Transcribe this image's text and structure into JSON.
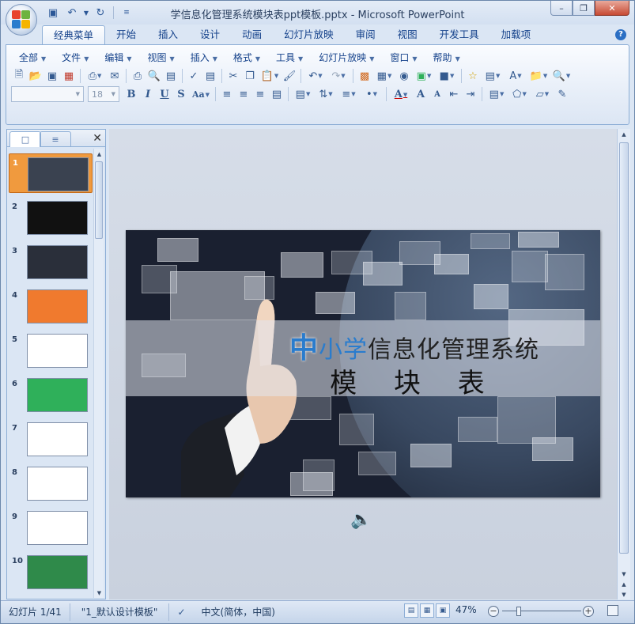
{
  "window": {
    "title": "学信息化管理系统模块表ppt模板.pptx - Microsoft PowerPoint"
  },
  "ribbon_tabs": [
    "经典菜单",
    "开始",
    "插入",
    "设计",
    "动画",
    "幻灯片放映",
    "审阅",
    "视图",
    "开发工具",
    "加载项"
  ],
  "classic_menus": [
    "全部",
    "文件",
    "编辑",
    "视图",
    "插入",
    "格式",
    "工具",
    "幻灯片放映",
    "窗口",
    "帮助"
  ],
  "font": {
    "name_placeholder": "",
    "size": "18"
  },
  "slide": {
    "title_big": "中",
    "title_mid": "小学",
    "title_rest": "信息化管理系统",
    "subtitle": "模 块 表"
  },
  "thumbnails": [
    {
      "num": "1",
      "bg": "#3a4250"
    },
    {
      "num": "2",
      "bg": "#111111"
    },
    {
      "num": "3",
      "bg": "#2a2f3a"
    },
    {
      "num": "4",
      "bg": "#f07a2e"
    },
    {
      "num": "5",
      "bg": "#ffffff"
    },
    {
      "num": "6",
      "bg": "#2fb05a"
    },
    {
      "num": "7",
      "bg": "#ffffff"
    },
    {
      "num": "8",
      "bg": "#ffffff"
    },
    {
      "num": "9",
      "bg": "#ffffff"
    },
    {
      "num": "10",
      "bg": "#2f8a4a"
    }
  ],
  "status": {
    "slide_info": "幻灯片 1/41",
    "theme": "\"1_默认设计模板\"",
    "language": "中文(简体，中国)",
    "zoom": "47%"
  },
  "colors": {
    "accent": "#2a7ccd",
    "selected_thumb": "#f09a3e",
    "orange": "#f07a2e",
    "green": "#2fb05a"
  }
}
